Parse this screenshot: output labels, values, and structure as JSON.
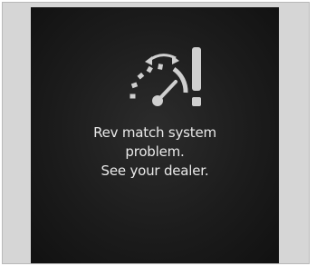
{
  "display": {
    "icons": {
      "gauge": "rev-match-gauge-icon",
      "warning": "exclamation-icon"
    },
    "message": {
      "line1": "Rev match system",
      "line2": "problem.",
      "line3": "See your dealer."
    },
    "colors": {
      "background": "#1c1c1c",
      "text": "#e9e9e9",
      "icon": "#cfcfcf"
    }
  }
}
